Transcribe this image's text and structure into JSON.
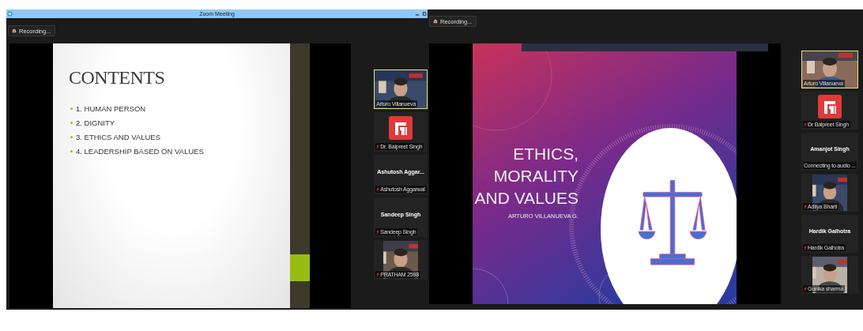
{
  "screens": [
    {
      "window": {
        "title": "Zoom Meeting"
      },
      "recording": "Recording...",
      "slide": {
        "kind": "contents",
        "title": "CONTENTS",
        "items": [
          "1. HUMAN PERSON",
          "2. DIGNITY",
          "3. ETHICS AND VALUES",
          "4. LEADERSHIP BASED ON VALUES"
        ]
      },
      "participants": [
        {
          "kind": "video",
          "label": "Arturo Villanueva",
          "muted": false,
          "speaking": true
        },
        {
          "kind": "logo",
          "label": "Dr. Balpreet Singh",
          "muted": true,
          "speaking": false
        },
        {
          "kind": "name",
          "display": "Ashutosh  Aggar...",
          "label": "Ashutosh Aggarwal",
          "muted": true,
          "speaking": false
        },
        {
          "kind": "name",
          "display": "Sandeep Singh",
          "label": "Sandeep Singh",
          "muted": true,
          "speaking": false
        },
        {
          "kind": "video",
          "label": "PRATHAM 2598",
          "muted": true,
          "speaking": false
        }
      ]
    },
    {
      "recording": "Recording...",
      "slide": {
        "kind": "title",
        "title_lines": [
          "ETHICS,",
          "MORALITY",
          "AND VALUES"
        ],
        "subtitle": "ARTURO VILLANUEVA G."
      },
      "participants": [
        {
          "kind": "video",
          "label": "Arturo Villanueva",
          "muted": false,
          "speaking": true
        },
        {
          "kind": "logo",
          "label": "Dr Balpreet Singh",
          "muted": true,
          "speaking": false
        },
        {
          "kind": "name",
          "display": "Amanjot Singh",
          "label": "Connecting to audio ...",
          "muted": false,
          "speaking": false
        },
        {
          "kind": "video",
          "label": "Aditya Bharti",
          "muted": true,
          "speaking": false
        },
        {
          "kind": "name",
          "display": "Hardik Galhotra",
          "label": "Hardik Galhotra",
          "muted": true,
          "speaking": false
        },
        {
          "kind": "video",
          "label": "Gunika sharma",
          "muted": true,
          "speaking": false
        }
      ]
    }
  ]
}
